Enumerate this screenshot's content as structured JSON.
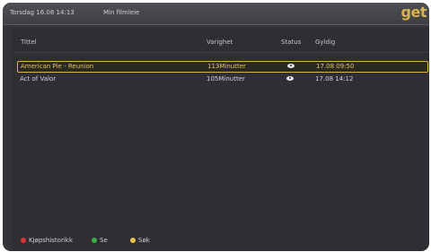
{
  "topbar": {
    "datetime": "Torsdag 16.08 14:13",
    "title": "Min filmleie",
    "logo": "get"
  },
  "table": {
    "headers": [
      "Tittel",
      "Varighet",
      "Status",
      "Gyldig"
    ],
    "rows": [
      {
        "title": "American Pie - Reunion",
        "duration": "113Minutter",
        "status_icon": "eye-icon",
        "valid": "17.08 09:50",
        "selected": true
      },
      {
        "title": "Act of Valor",
        "duration": "105Minutter",
        "status_icon": "eye-icon",
        "valid": "17.08 14:12",
        "selected": false
      }
    ]
  },
  "footer": {
    "buttons": [
      {
        "label": "Kjøpshistorikk",
        "color": "#d9363b"
      },
      {
        "label": "Se",
        "color": "#3dad4b"
      },
      {
        "label": "Søk",
        "color": "#e3c24c"
      }
    ]
  },
  "colors": {
    "accent": "#d8b44a",
    "background": "#343338"
  }
}
